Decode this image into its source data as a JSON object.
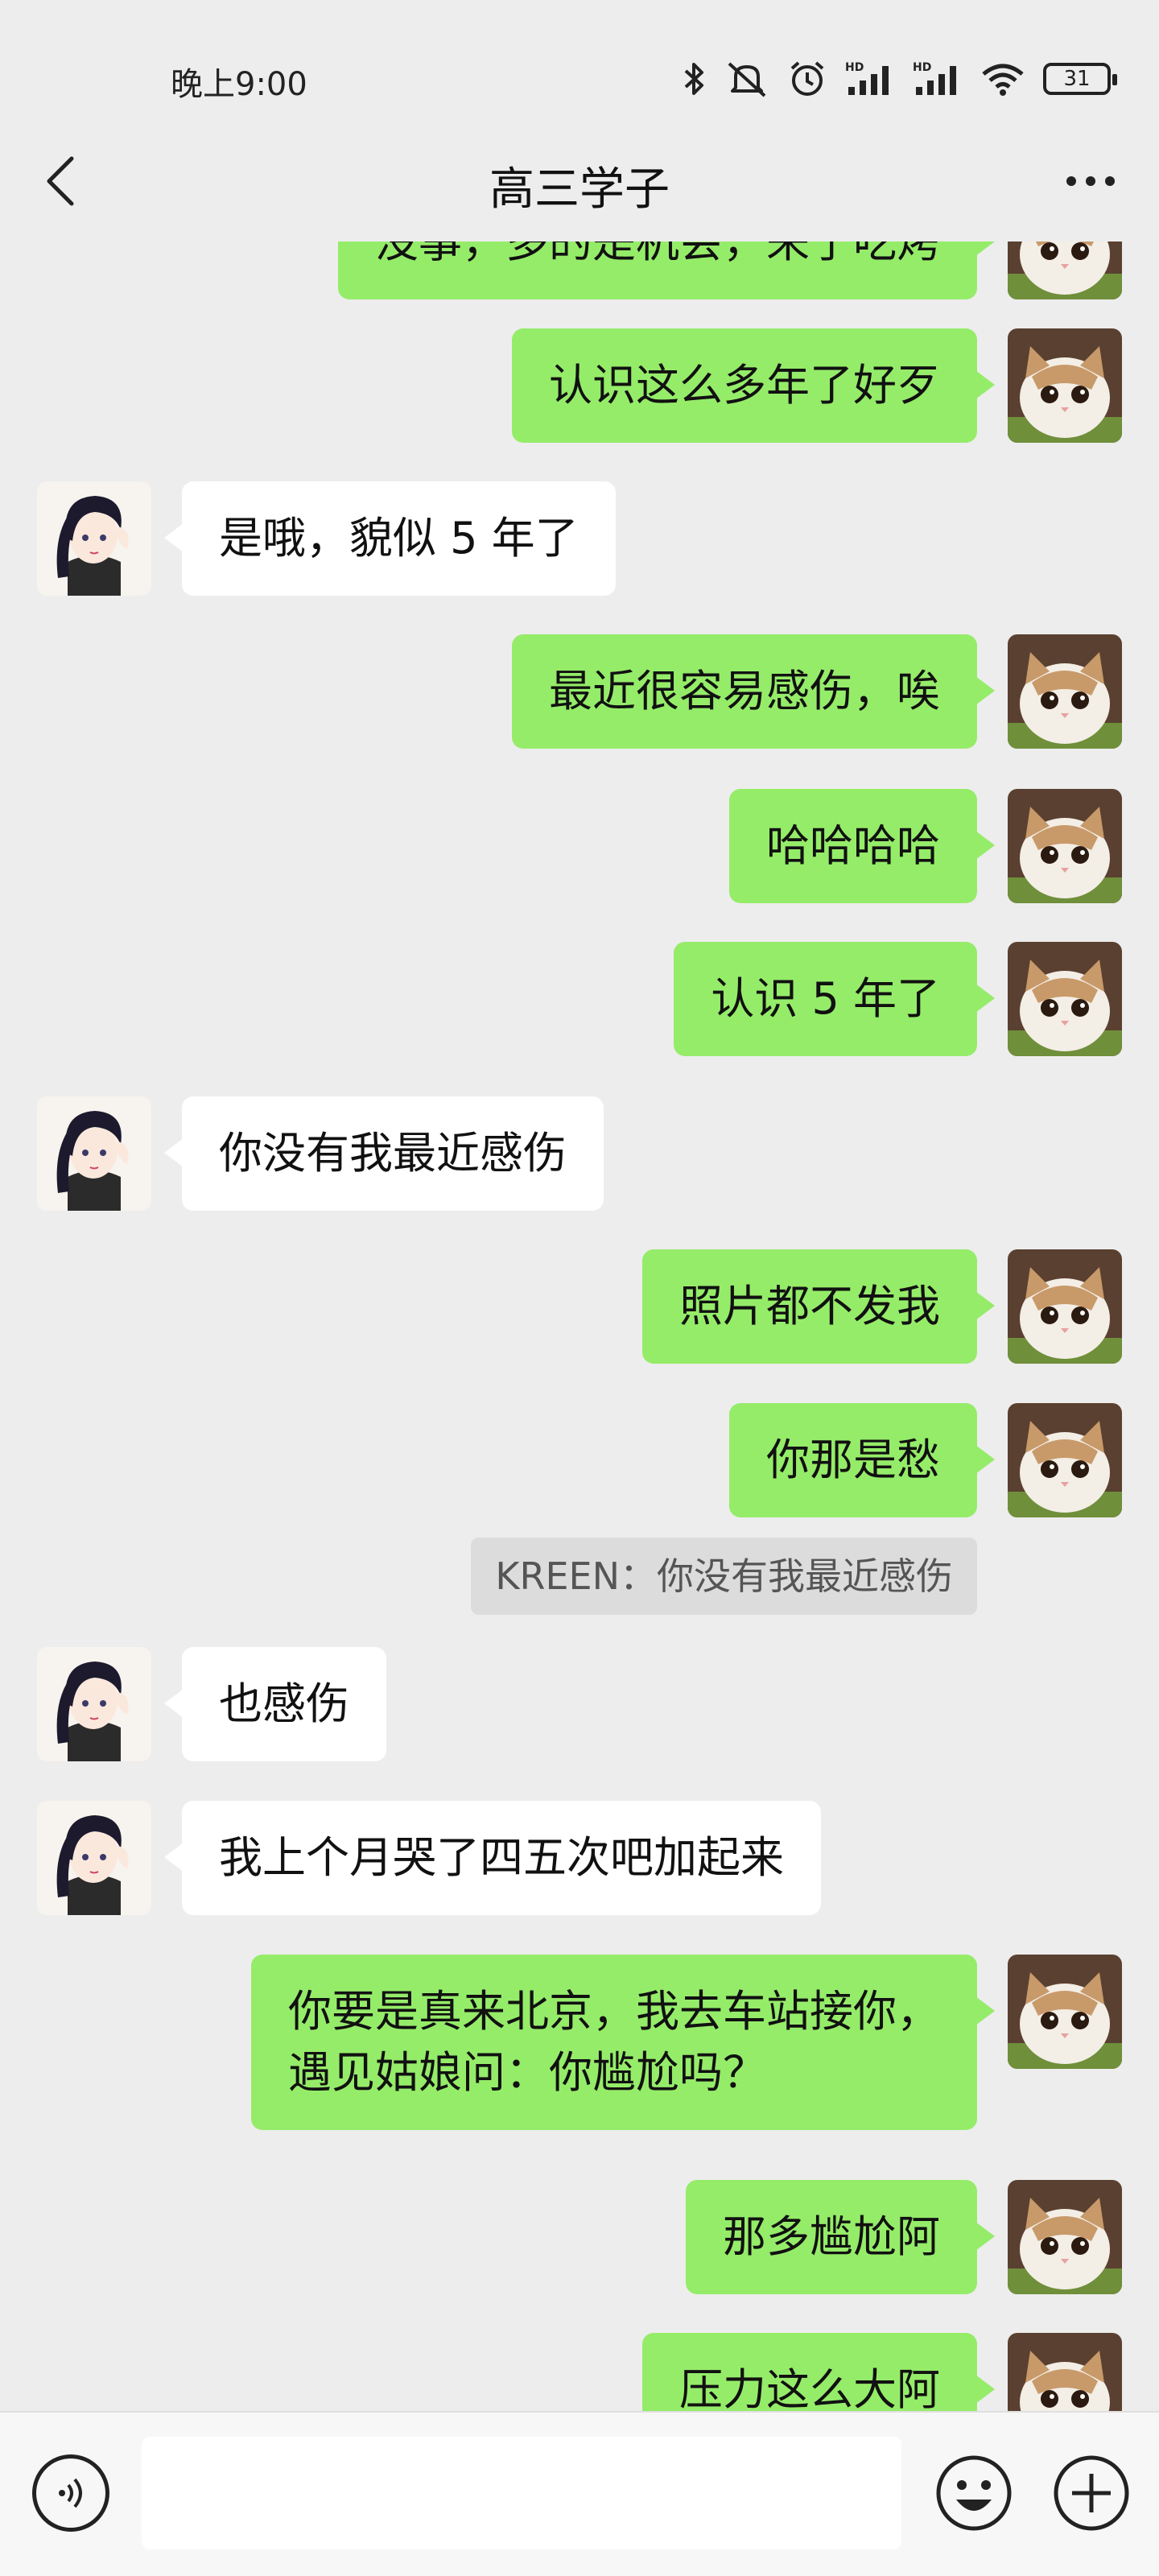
{
  "status_bar": {
    "time": "晚上9:00",
    "battery": "31",
    "icons": [
      "bluetooth-icon",
      "mute-icon",
      "alarm-icon",
      "signal-hd-1-icon",
      "signal-hd-2-icon",
      "wifi-icon",
      "battery-icon"
    ]
  },
  "nav": {
    "title": "高三学子",
    "back_icon": "chevron-left-icon",
    "more_icon": "more-dots-icon"
  },
  "messages": [
    {
      "side": "out",
      "text": "没事，多的是机会，来了吃烤"
    },
    {
      "side": "out",
      "text": "认识这么多年了好歹"
    },
    {
      "side": "in",
      "text": "是哦，貌似 5 年了"
    },
    {
      "side": "out",
      "text": "最近很容易感伤，唉"
    },
    {
      "side": "out",
      "text": "哈哈哈哈"
    },
    {
      "side": "out",
      "text": "认识 5 年了"
    },
    {
      "side": "in",
      "text": "你没有我最近感伤"
    },
    {
      "side": "out",
      "text": "照片都不发我"
    },
    {
      "side": "out",
      "text": "你那是愁"
    },
    {
      "side": "quote",
      "text": "KREEN：你没有我最近感伤"
    },
    {
      "side": "in",
      "text": "也感伤"
    },
    {
      "side": "in",
      "text": "我上个月哭了四五次吧加起来"
    },
    {
      "side": "out",
      "text": "你要是真来北京，我去车站接你，\n遇见姑娘问：你尴尬吗？"
    },
    {
      "side": "out",
      "text": "那多尴尬阿"
    },
    {
      "side": "out",
      "text": "压力这么大阿"
    }
  ],
  "input_bar": {
    "placeholder": "",
    "voice_icon": "voice-icon",
    "emoji_icon": "emoji-icon",
    "plus_icon": "plus-icon"
  },
  "colors": {
    "background": "#ededed",
    "outgoing_bubble": "#95ec69",
    "incoming_bubble": "#ffffff",
    "quote_bubble": "#dcdcdc"
  }
}
